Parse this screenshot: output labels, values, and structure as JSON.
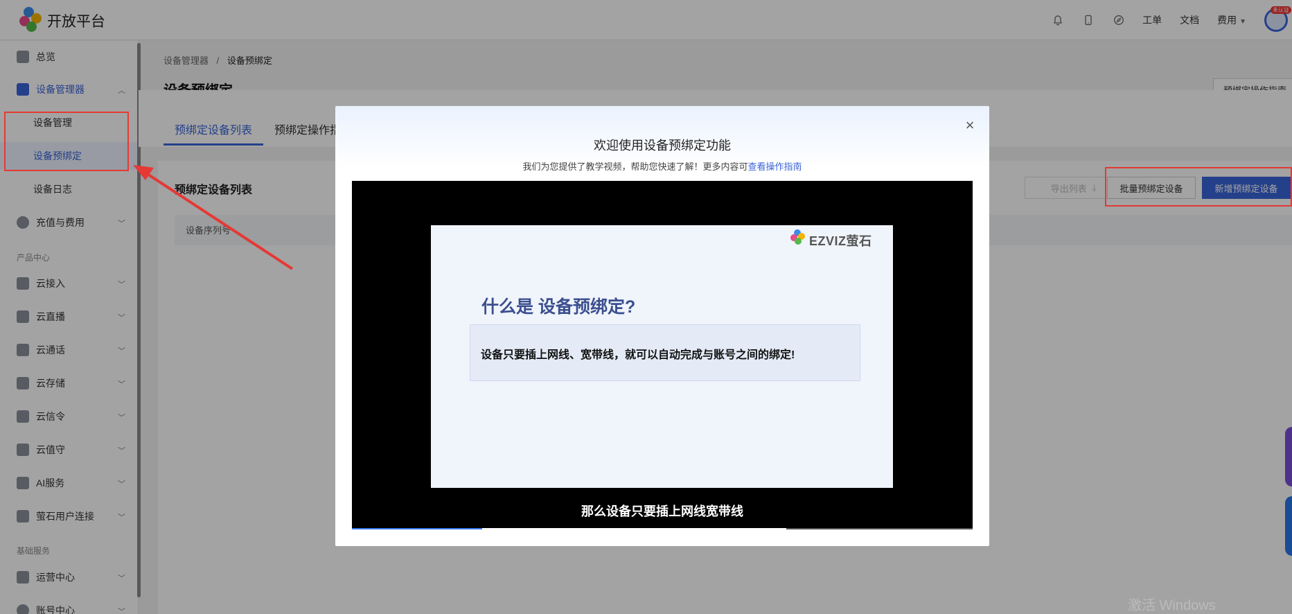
{
  "header": {
    "brand": "开放平台",
    "links": {
      "ticket": "工单",
      "docs": "文档",
      "fees": "费用"
    },
    "avatar_badge": "未认证",
    "icons": [
      "bell-icon",
      "phone-icon",
      "compass-icon"
    ]
  },
  "sidebar": {
    "overview": "总览",
    "device_manager": "设备管理器",
    "sub": {
      "device_mgmt": "设备管理",
      "device_prebind": "设备预绑定",
      "device_log": "设备日志"
    },
    "recharge": "充值与费用",
    "section_product": "产品中心",
    "cloud_access": "云接入",
    "cloud_live": "云直播",
    "cloud_call": "云通话",
    "cloud_storage": "云存储",
    "cloud_signal": "云信令",
    "cloud_guard": "云值守",
    "ai_service": "AI服务",
    "ezviz_user": "萤石用户连接",
    "section_basic": "基础服务",
    "ops_center": "运营中心",
    "account_center": "账号中心"
  },
  "main": {
    "breadcrumb": {
      "root": "设备管理器",
      "sep": "/",
      "current": "设备预绑定"
    },
    "title": "设备预绑定",
    "guide_button": "预绑定操作指南",
    "tabs": {
      "list": "预绑定设备列表",
      "guide": "预绑定操作指南"
    },
    "list_title": "预绑定设备列表",
    "buttons": {
      "export": "导出列表",
      "batch": "批量预绑定设备",
      "new": "新增预绑定设备"
    },
    "table_header": "设备序列号",
    "watermark": "激活 Windows"
  },
  "modal": {
    "title": "欢迎使用设备预绑定功能",
    "subtitle": "我们为您提供了教学视频，帮助您快速了解！更多内容可",
    "link": "查看操作指南",
    "close": "×",
    "video": {
      "brand": "EZVIZ萤石",
      "question": "什么是 设备预绑定?",
      "statement": "设备只要插上网线、宽带线，就可以自动完成与账号之间的绑定!",
      "caption": "那么设备只要插上网线宽带线",
      "progress": 0.21,
      "buffered": 0.7
    }
  },
  "colors": {
    "accent": "#3a64d8",
    "annotation": "#e53935"
  }
}
